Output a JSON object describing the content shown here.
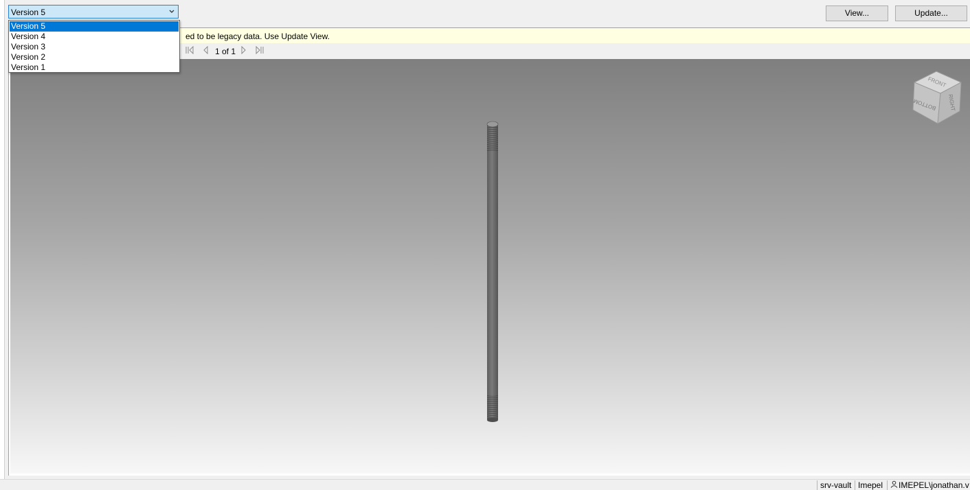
{
  "version_select": {
    "selected": "Version 5",
    "options": [
      "Version 5",
      "Version 4",
      "Version 3",
      "Version 2",
      "Version 1"
    ]
  },
  "toolbar": {
    "view_label": "View...",
    "update_label": "Update..."
  },
  "infobar": {
    "message": "ed to be legacy data. Use Update View."
  },
  "pager": {
    "page_text": "1 of 1"
  },
  "viewcube": {
    "front": "FRONT",
    "right": "RIGHT",
    "bottom": "BOTTOM"
  },
  "statusbar": {
    "server": "srv-vault",
    "vault": "Imepel",
    "user": "IMEPEL\\jonathan.v"
  },
  "icons": {
    "dropdown": "chevron-down-icon",
    "first": "first-page-icon",
    "prev": "previous-page-icon",
    "next": "next-page-icon",
    "last": "last-page-icon",
    "user": "user-icon"
  },
  "colors": {
    "selection": "#0078d7",
    "infobar": "#ffffe1",
    "select_highlight": "#cce8f8"
  }
}
